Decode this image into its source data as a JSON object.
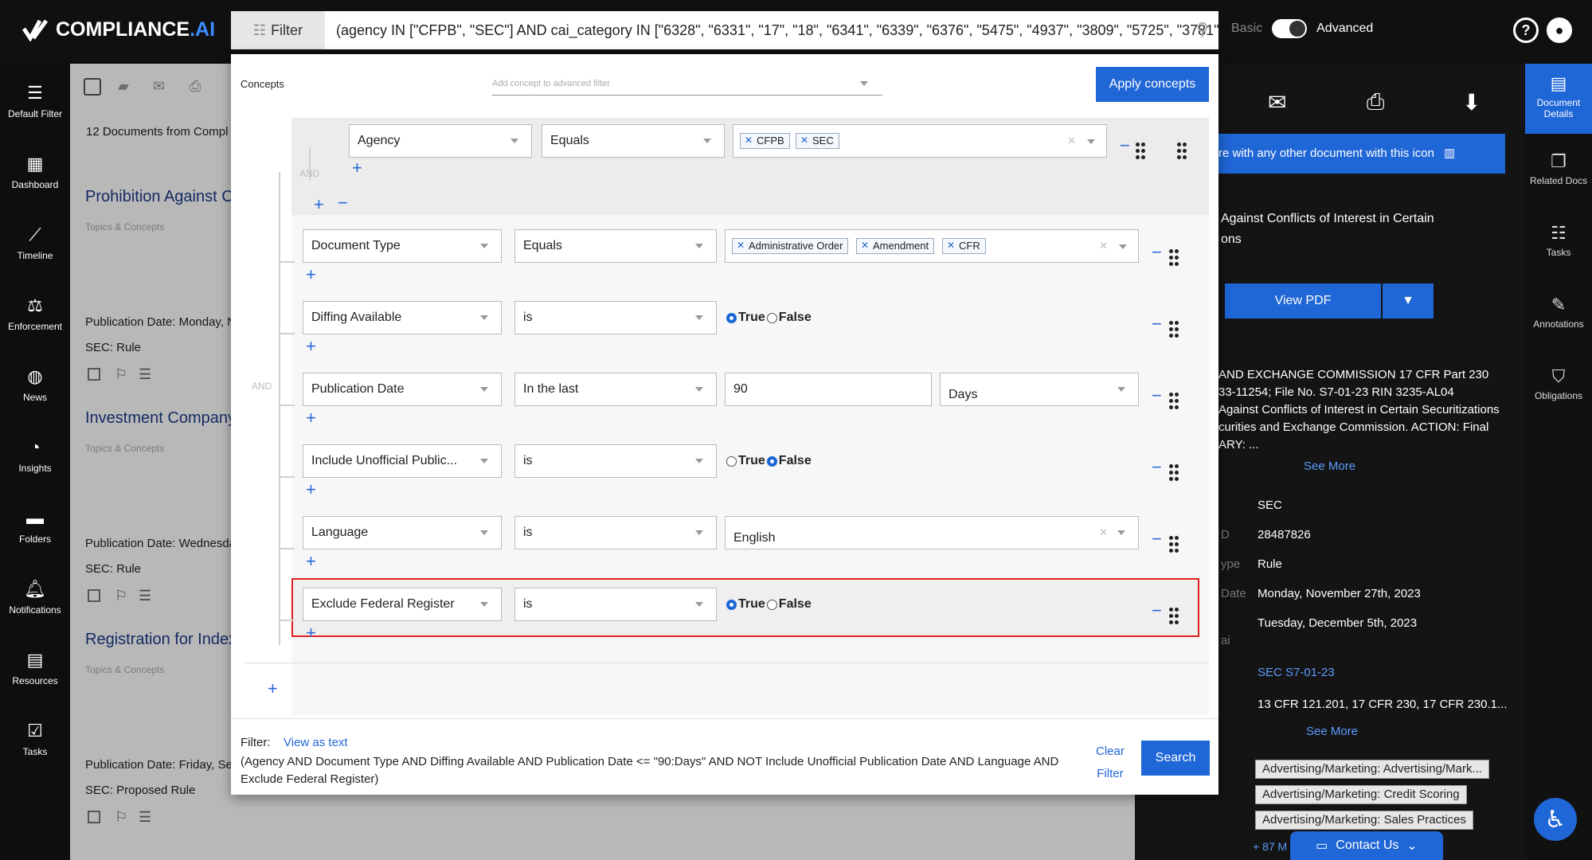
{
  "app": {
    "logo_main": "COMPLIANCE",
    "logo_accent": ".AI",
    "filter_button": "Filter",
    "query": "(agency IN [\"CFPB\", \"SEC\"] AND cai_category IN [\"6328\", \"6331\", \"17\", \"18\", \"6341\", \"6339\", \"6376\", \"5475\", \"4937\", \"3809\", \"5725\", \"3781\",",
    "mode_basic": "Basic",
    "mode_advanced": "Advanced"
  },
  "leftnav": [
    {
      "label": "Default Filter",
      "icon": "filter-icon"
    },
    {
      "label": "Dashboard",
      "icon": "dashboard-icon"
    },
    {
      "label": "Timeline",
      "icon": "timeline-icon"
    },
    {
      "label": "Enforcement",
      "icon": "enforcement-icon"
    },
    {
      "label": "News",
      "icon": "globe-icon"
    },
    {
      "label": "Insights",
      "icon": "pie-chart-icon"
    },
    {
      "label": "Folders",
      "icon": "folder-icon"
    },
    {
      "label": "Notifications",
      "icon": "bell-icon"
    },
    {
      "label": "Resources",
      "icon": "resources-icon"
    },
    {
      "label": "Tasks",
      "icon": "tasks-icon"
    }
  ],
  "doclist": {
    "count_text": "12 Documents from Compl",
    "docs": [
      {
        "title": "Prohibition Against C",
        "topics": "Topics & Concepts",
        "date": "Publication Date: Monday, N",
        "type": "SEC:  Rule"
      },
      {
        "title": "Investment Company",
        "topics": "Topics & Concepts",
        "date": "Publication Date: Wednesda",
        "type": "SEC:  Rule"
      },
      {
        "title": "Registration for Index",
        "topics": "Topics & Concepts",
        "date": "Publication Date: Friday, Se",
        "type": "SEC:  Proposed Rule"
      }
    ]
  },
  "rightstrip": [
    {
      "label": "Document Details",
      "icon": "document-icon"
    },
    {
      "label": "Related Docs",
      "icon": "related-docs-icon"
    },
    {
      "label": "Tasks",
      "icon": "checklist-icon"
    },
    {
      "label": "Annotations",
      "icon": "pencil-icon"
    },
    {
      "label": "Obligations",
      "icon": "shield-icon"
    }
  ],
  "rightpanel": {
    "compare_banner": "re with any other document with this icon",
    "title_line1": "Against Conflicts of Interest in Certain",
    "title_line2": "ons",
    "view_pdf": "View PDF",
    "summary_lines": [
      "AND EXCHANGE COMMISSION 17 CFR Part 230",
      "33-11254; File No. S7-01-23 RIN 3235-AL04",
      "Against Conflicts of Interest in Certain Securitizations",
      "curities and Exchange Commission. ACTION: Final",
      "ARY: ..."
    ],
    "see_more": "See More",
    "meta": [
      {
        "label": "",
        "value": "SEC"
      },
      {
        "label": "D",
        "value": "28487826"
      },
      {
        "label": "ype",
        "value": "Rule"
      },
      {
        "label": "Date",
        "value": "Monday, November 27th, 2023"
      },
      {
        "label": "",
        "value": "Tuesday, December 5th, 2023"
      }
    ],
    "ai_label": "ai",
    "docket_link": "SEC S7-01-23",
    "cfr_text": "13 CFR 121.201, 17 CFR 230, 17 CFR 230.1...",
    "see_more_2": "See More",
    "tags": [
      "Advertising/Marketing: Advertising/Mark...",
      "Advertising/Marketing: Credit Scoring",
      "Advertising/Marketing: Sales Practices"
    ],
    "more_tags": "+ 87 M",
    "contact_us": "Contact Us"
  },
  "modal": {
    "concepts_label": "Concepts",
    "concept_placeholder": "Add concept to advanced filter",
    "apply_button": "Apply concepts",
    "and_label": "AND",
    "rows": [
      {
        "field": "Agency",
        "op": "Equals",
        "chips": [
          "CFPB",
          "SEC"
        ]
      },
      {
        "field": "Document Type",
        "op": "Equals",
        "chips": [
          "Administrative Order",
          "Amendment",
          "CFR"
        ]
      },
      {
        "field": "Diffing Available",
        "op": "is",
        "true_label": "True",
        "false_label": "False"
      },
      {
        "field": "Publication Date",
        "op": "In the last",
        "value": "90",
        "unit": "Days"
      },
      {
        "field": "Include Unofficial Public...",
        "op": "is",
        "true_label": "True",
        "false_label": "False"
      },
      {
        "field": "Language",
        "op": "is",
        "value": "English"
      },
      {
        "field": "Exclude Federal Register",
        "op": "is",
        "true_label": "True",
        "false_label": "False"
      }
    ],
    "filter_label": "Filter:",
    "view_as_text": "View as text",
    "filter_expression": "(Agency AND Document Type AND Diffing Available AND Publication Date <= \"90:Days\" AND NOT Include Unofficial Publication Date AND Language AND Exclude Federal Register)",
    "clear_filter_1": "Clear",
    "clear_filter_2": "Filter",
    "search_button": "Search"
  },
  "colors": {
    "accent": "#1f66d6",
    "highlight": "#e02020"
  }
}
